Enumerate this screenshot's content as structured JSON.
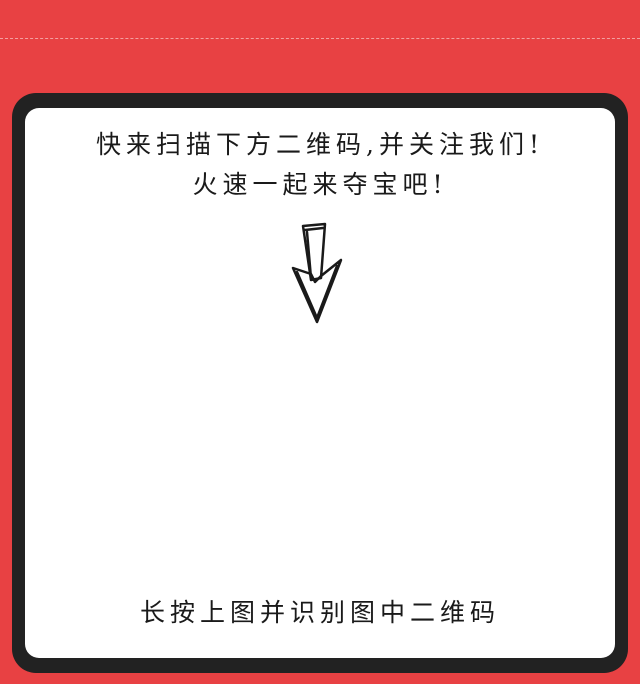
{
  "page": {
    "headline_line1": "快来扫描下方二维码,并关注我们!",
    "headline_line2": "火速一起来夺宝吧!",
    "footer_tip": "长按上图并识别图中二维码"
  },
  "icons": {
    "arrow": "down-arrow-icon"
  },
  "colors": {
    "background": "#e84143",
    "card_border": "#222222",
    "card_fill": "#ffffff",
    "text": "#1a1a1a"
  }
}
